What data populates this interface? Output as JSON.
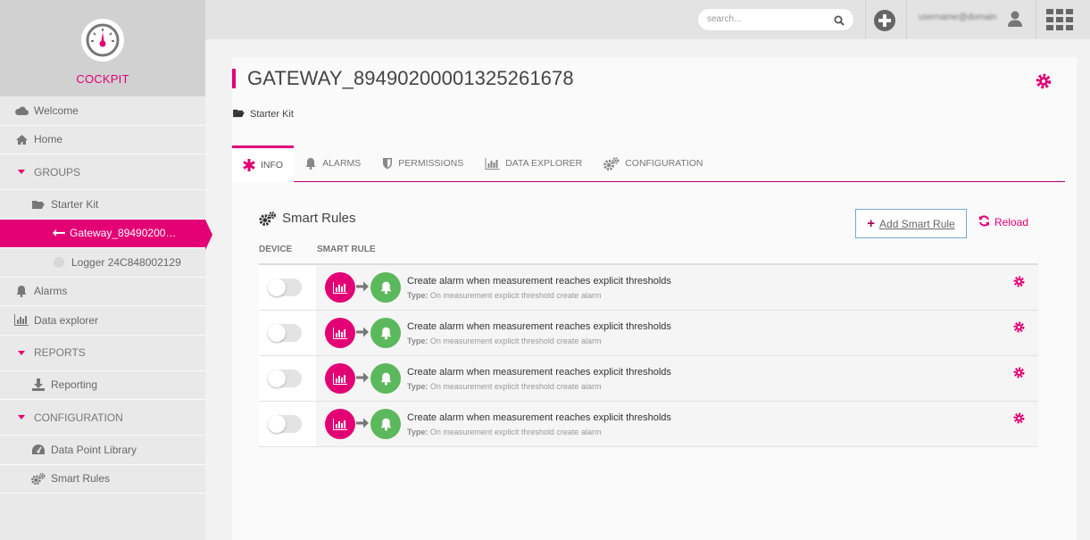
{
  "colors": {
    "accent": "#e20074",
    "success": "#5cb85c",
    "sidebar_bg": "#e9e9e9"
  },
  "brand": {
    "name": "COCKPIT",
    "icon": "gauge-icon"
  },
  "sidebar": {
    "items": [
      {
        "label": "Welcome",
        "icon": "cloud-icon"
      },
      {
        "label": "Home",
        "icon": "home-icon"
      },
      {
        "label": "GROUPS",
        "icon": "caret-down-icon"
      },
      {
        "label": "Starter Kit",
        "icon": "folder-open-icon"
      },
      {
        "label": "Gateway_89490200…",
        "icon": "arrow-left-icon"
      },
      {
        "label": "Logger 24C848002129",
        "icon": "status-dot-icon"
      },
      {
        "label": "Alarms",
        "icon": "bell-icon"
      },
      {
        "label": "Data explorer",
        "icon": "bar-chart-icon"
      },
      {
        "label": "REPORTS",
        "icon": "caret-down-icon"
      },
      {
        "label": "Reporting",
        "icon": "download-icon"
      },
      {
        "label": "CONFIGURATION",
        "icon": "caret-down-icon"
      },
      {
        "label": "Data Point Library",
        "icon": "dashboard-icon"
      },
      {
        "label": "Smart Rules",
        "icon": "cogs-icon"
      }
    ]
  },
  "topbar": {
    "search_placeholder": "search...",
    "user_name": "username@domain"
  },
  "page": {
    "title": "GATEWAY_89490200001325261678",
    "breadcrumb": "Starter Kit"
  },
  "tabs": [
    {
      "label": "INFO",
      "icon": "asterisk-icon"
    },
    {
      "label": "ALARMS",
      "icon": "bell-icon"
    },
    {
      "label": "PERMISSIONS",
      "icon": "shield-icon"
    },
    {
      "label": "DATA EXPLORER",
      "icon": "bar-chart-icon"
    },
    {
      "label": "CONFIGURATION",
      "icon": "cogs-icon"
    }
  ],
  "smart_rules": {
    "heading": "Smart Rules",
    "add_label": "Add Smart Rule",
    "reload_label": "Reload",
    "col_device": "DEVICE",
    "col_rule": "SMART RULE",
    "rows": [
      {
        "name": "Create alarm when measurement reaches explicit thresholds",
        "type_label": "Type:",
        "type": "On measurement explicit threshold create alarm",
        "enabled": false
      },
      {
        "name": "Create alarm when measurement reaches explicit thresholds",
        "type_label": "Type:",
        "type": "On measurement explicit threshold create alarm",
        "enabled": false
      },
      {
        "name": "Create alarm when measurement reaches explicit thresholds",
        "type_label": "Type:",
        "type": "On measurement explicit threshold create alarm",
        "enabled": false
      },
      {
        "name": "Create alarm when measurement reaches explicit thresholds",
        "type_label": "Type:",
        "type": "On measurement explicit threshold create alarm",
        "enabled": false
      }
    ]
  }
}
